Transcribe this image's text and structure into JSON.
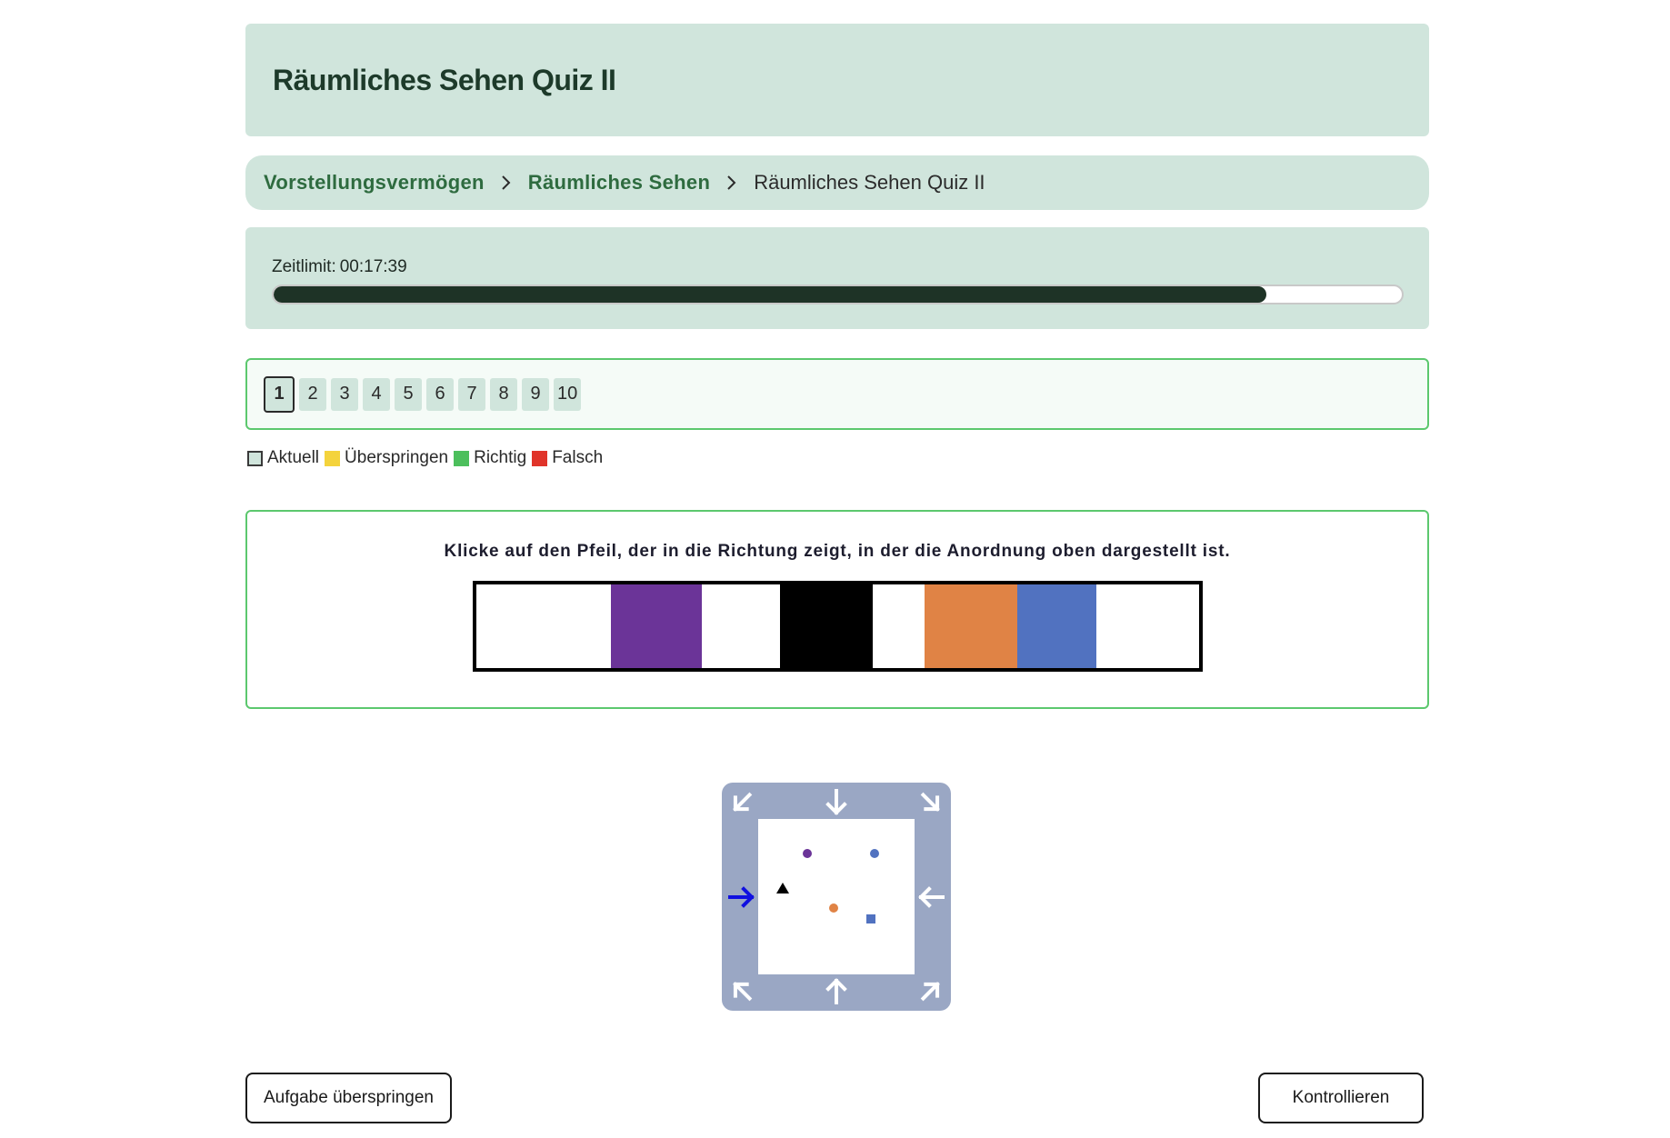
{
  "page": {
    "title": "Räumliches Sehen Quiz II"
  },
  "breadcrumb": {
    "items": [
      {
        "label": "Vorstellungsvermögen"
      },
      {
        "label": "Räumliches Sehen"
      },
      {
        "label": "Räumliches Sehen Quiz II"
      }
    ]
  },
  "timer": {
    "label": "Zeitlimit:",
    "value": "00:17:39",
    "progress_percent": 88
  },
  "question_nav": {
    "numbers": [
      "1",
      "2",
      "3",
      "4",
      "5",
      "6",
      "7",
      "8",
      "9",
      "10"
    ],
    "current": "1"
  },
  "legend": {
    "current": "Aktuell",
    "skip": "Überspringen",
    "right": "Richtig",
    "wrong": "Falsch"
  },
  "question": {
    "text": "Klicke auf den Pfeil, der in die Richtung zeigt, in der die Anordnung oben dargestellt ist.",
    "strip_colors": {
      "purple": "#6b3498",
      "black": "#000000",
      "orange": "#e08345",
      "blue": "#5172c0"
    }
  },
  "compass": {
    "highlight_color": "#1010e0",
    "highlighted_arrow": "left",
    "shape_colors": {
      "purple": "#6b3498",
      "blue": "#5172c0",
      "black": "#000000",
      "orange": "#e08345"
    }
  },
  "buttons": {
    "skip": "Aufgabe überspringen",
    "check": "Kontrollieren"
  },
  "colors": {
    "panel_bg": "#d0e5dc",
    "accent_green": "#5cc86e",
    "dark_green": "#1e3326"
  }
}
